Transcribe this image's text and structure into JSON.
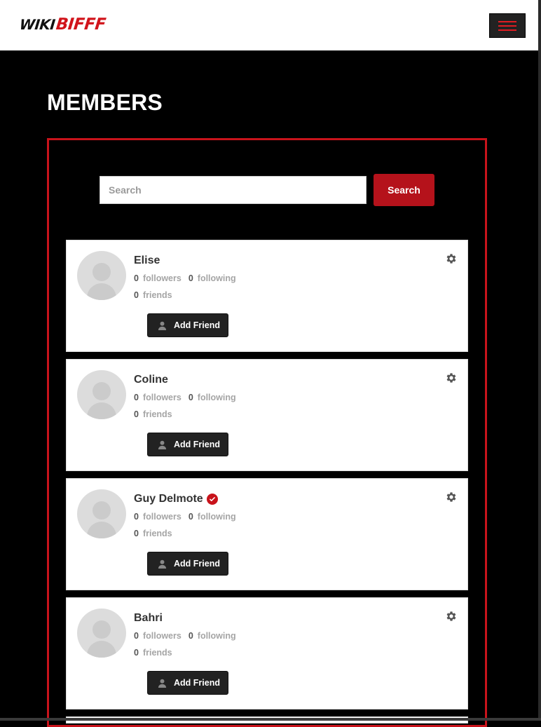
{
  "header": {
    "logo_part1": "WIKI",
    "logo_part2": "BIFFF",
    "menu_icon": "hamburger-icon"
  },
  "page": {
    "title": "MEMBERS"
  },
  "search": {
    "placeholder": "Search",
    "value": "",
    "button_label": "Search"
  },
  "members": [
    {
      "name": "Elise",
      "followers": "0",
      "following": "0",
      "friends": "0",
      "verified": false
    },
    {
      "name": "Coline",
      "followers": "0",
      "following": "0",
      "friends": "0",
      "verified": false
    },
    {
      "name": "Guy Delmote",
      "followers": "0",
      "following": "0",
      "friends": "0",
      "verified": true
    },
    {
      "name": "Bahri",
      "followers": "0",
      "following": "0",
      "friends": "0",
      "verified": false
    }
  ],
  "labels": {
    "followers": "followers",
    "following": "following",
    "friends": "friends",
    "add_friend": "Add Friend"
  },
  "colors": {
    "accent": "#c8131b",
    "background": "#000000",
    "card": "#ffffff",
    "button_dark": "#222222"
  }
}
